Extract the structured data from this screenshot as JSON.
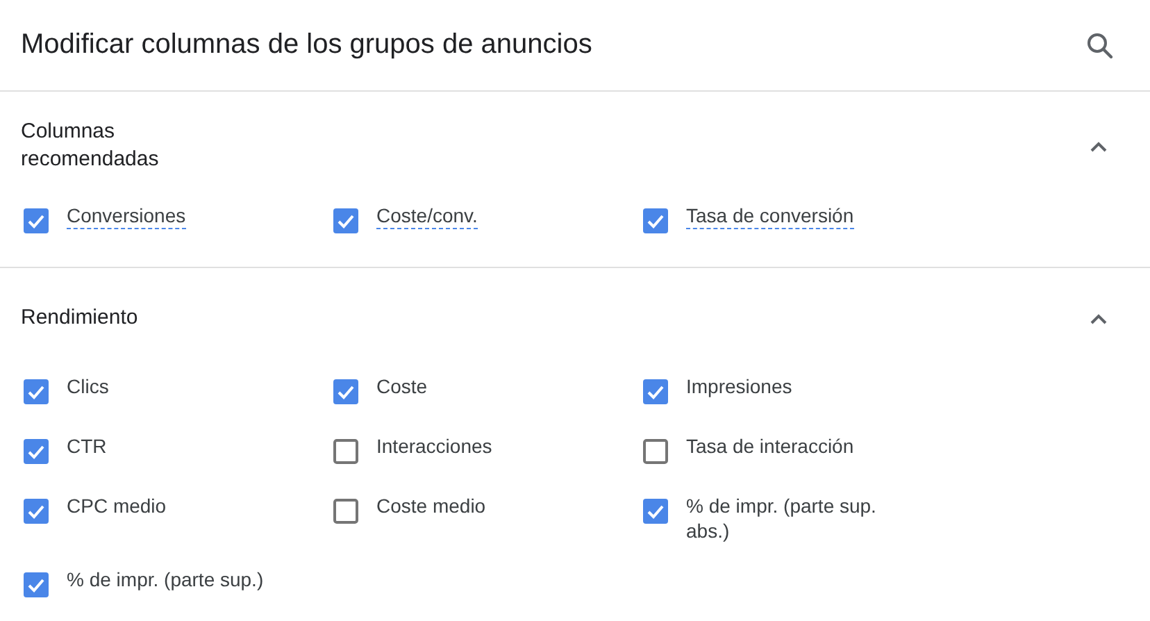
{
  "title": "Modificar columnas de los grupos de anuncios",
  "sections": [
    {
      "title": "Columnas\nrecomendadas",
      "expanded": true,
      "dashed_underline": true,
      "columns": [
        {
          "label": "Conversiones",
          "checked": true
        },
        {
          "label": "Coste/conv.",
          "checked": true
        },
        {
          "label": "Tasa de conversión",
          "checked": true
        }
      ]
    },
    {
      "title": "Rendimiento",
      "expanded": true,
      "dashed_underline": false,
      "columns": [
        {
          "label": "Clics",
          "checked": true
        },
        {
          "label": "Coste",
          "checked": true
        },
        {
          "label": "Impresiones",
          "checked": true
        },
        {
          "label": "CTR",
          "checked": true
        },
        {
          "label": "Interacciones",
          "checked": false
        },
        {
          "label": "Tasa de interacción",
          "checked": false
        },
        {
          "label": "CPC medio",
          "checked": true
        },
        {
          "label": "Coste medio",
          "checked": false
        },
        {
          "label": "% de impr. (parte sup. abs.)",
          "checked": true
        },
        {
          "label": "% de impr. (parte sup.)",
          "checked": true
        }
      ]
    }
  ]
}
